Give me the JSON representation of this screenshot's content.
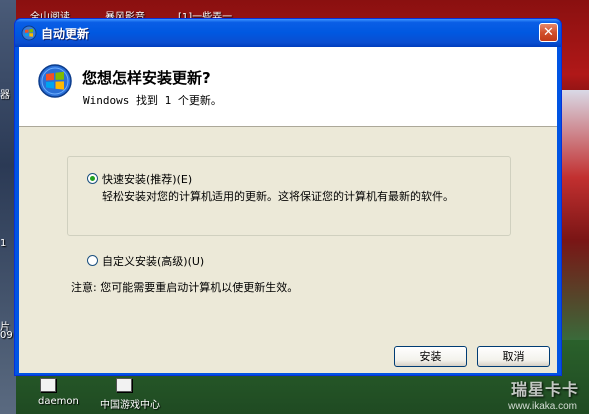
{
  "desktop": {
    "icons": [
      {
        "label": "全山阅读"
      },
      {
        "label": "暴风影音"
      },
      {
        "label": "[1]一些弄一"
      },
      {
        "label": "daemon"
      },
      {
        "label": "中国游戏中心"
      }
    ],
    "left_edge_texts": [
      "器",
      "片",
      "09",
      "1"
    ],
    "watermark": "瑞星卡卡",
    "watermark_url": "www.ikaka.com"
  },
  "window": {
    "title": "自动更新",
    "close_glyph": "✕",
    "header": {
      "title": "您想怎样安装更新?",
      "subtitle": "Windows 找到 1 个更新。"
    },
    "options": [
      {
        "label": "快速安装(推荐)(E)",
        "description": "轻松安装对您的计算机适用的更新。这将保证您的计算机有最新的软件。",
        "checked": true
      },
      {
        "label": "自定义安装(高级)(U)",
        "checked": false
      }
    ],
    "note": "注意: 您可能需要重启动计算机以使更新生效。",
    "buttons": {
      "install": "安装",
      "cancel": "取消"
    }
  },
  "colors": {
    "titlebar": "#0058e0",
    "client_bg": "#ece9d8",
    "close_button": "#d2502c",
    "radio_dot": "#21a121"
  }
}
